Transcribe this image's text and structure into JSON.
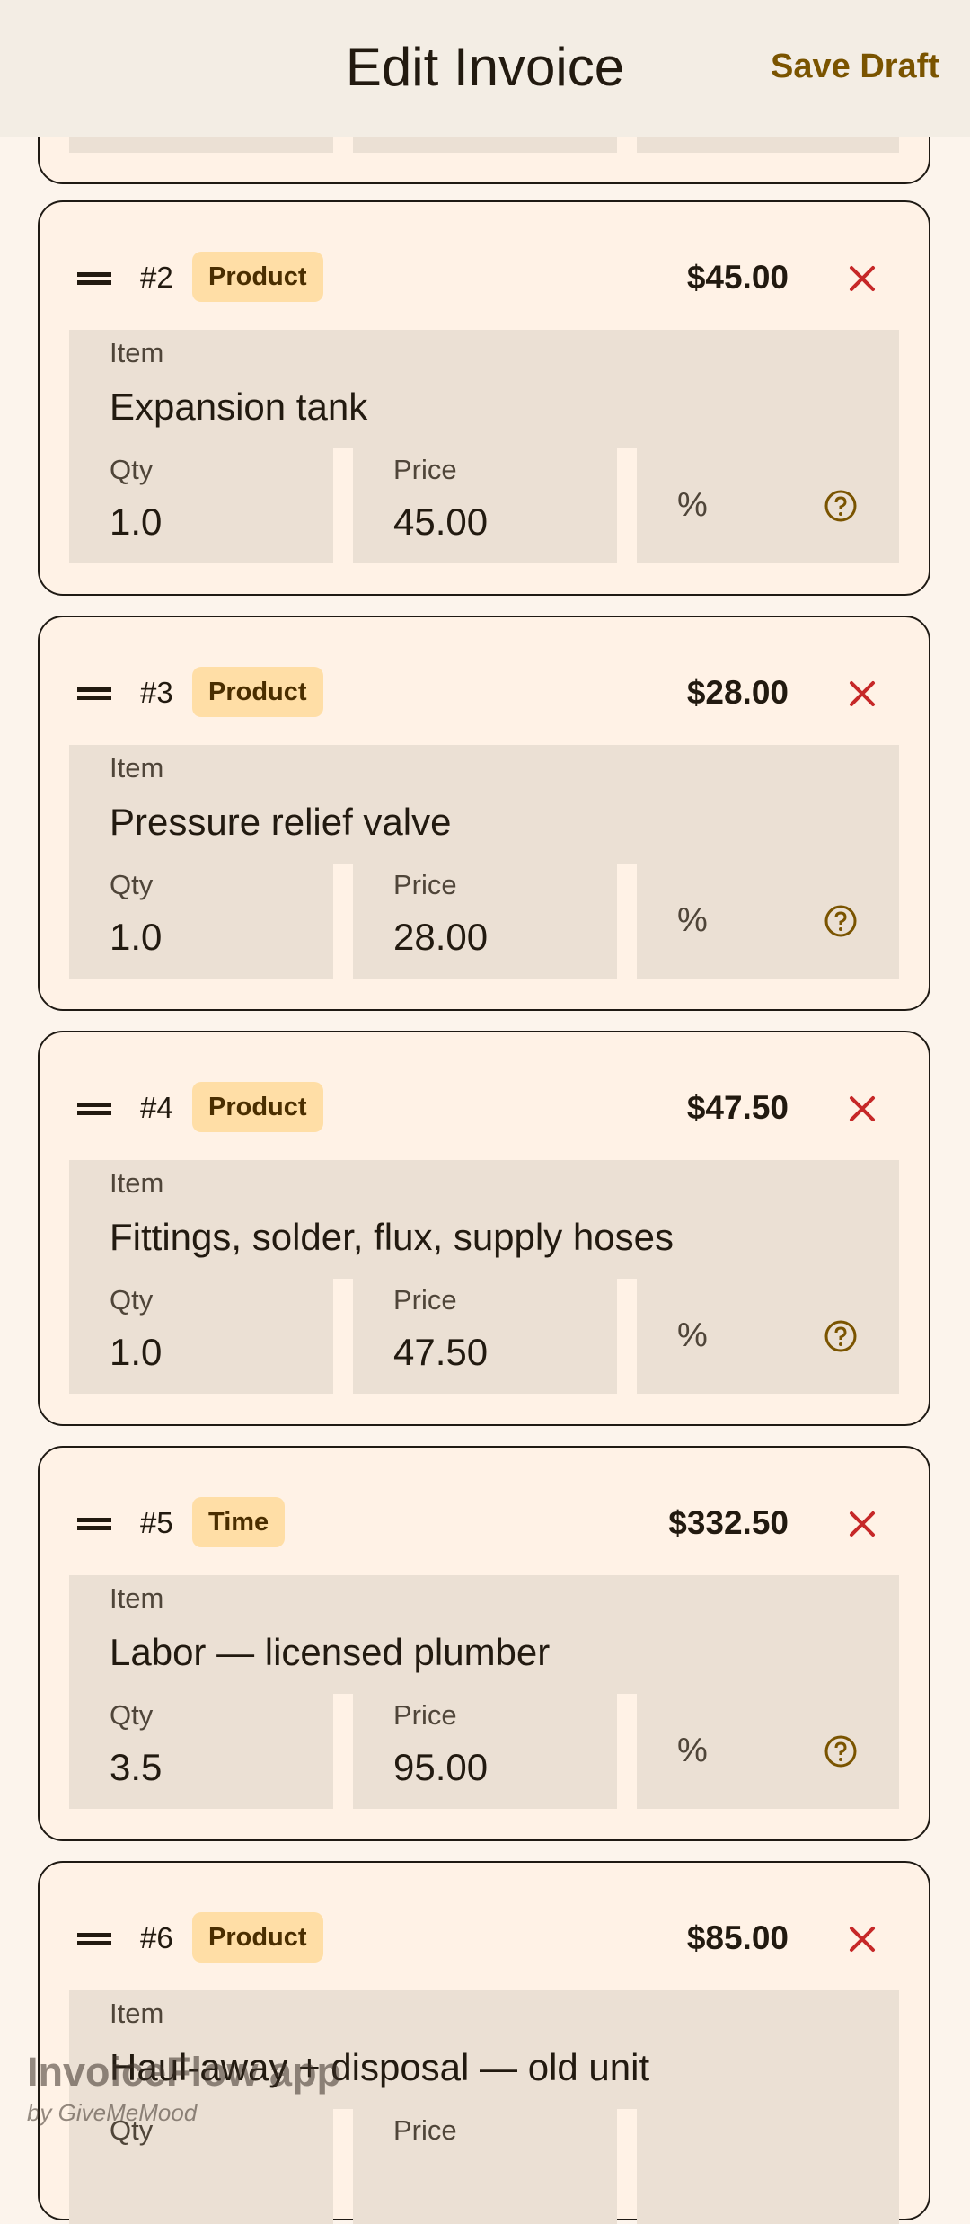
{
  "header": {
    "title": "Edit Invoice",
    "save_draft": "Save Draft"
  },
  "items": [
    {
      "index": "#2",
      "type": "Product",
      "total": "$45.00",
      "item_label": "Item",
      "item": "Expansion tank",
      "qty_label": "Qty",
      "qty": "1.0",
      "price_label": "Price",
      "price": "45.00",
      "discount_symbol": "%"
    },
    {
      "index": "#3",
      "type": "Product",
      "total": "$28.00",
      "item_label": "Item",
      "item": "Pressure relief valve",
      "qty_label": "Qty",
      "qty": "1.0",
      "price_label": "Price",
      "price": "28.00",
      "discount_symbol": "%"
    },
    {
      "index": "#4",
      "type": "Product",
      "total": "$47.50",
      "item_label": "Item",
      "item": "Fittings, solder, flux, supply hoses",
      "qty_label": "Qty",
      "qty": "1.0",
      "price_label": "Price",
      "price": "47.50",
      "discount_symbol": "%"
    },
    {
      "index": "#5",
      "type": "Time",
      "total": "$332.50",
      "item_label": "Item",
      "item": "Labor — licensed plumber",
      "qty_label": "Qty",
      "qty": "3.5",
      "price_label": "Price",
      "price": "95.00",
      "discount_symbol": "%"
    },
    {
      "index": "#6",
      "type": "Product",
      "total": "$85.00",
      "item_label": "Item",
      "item": "Haul-away + disposal — old unit",
      "qty_label": "Qty",
      "qty": "",
      "price_label": "Price",
      "price": "",
      "discount_symbol": "%"
    }
  ],
  "watermark": {
    "name": "InvoiceFlow app",
    "by": "by GiveMeMood"
  },
  "colors": {
    "accent": "#7A5400",
    "chip_bg": "#FFDEA6",
    "delete": "#C62828",
    "card_bg": "#FFF2E6",
    "field_bg": "#EBE0D4"
  },
  "icons": {
    "drag": "drag-handle-icon",
    "delete": "close-icon",
    "help": "help-circle-icon"
  }
}
